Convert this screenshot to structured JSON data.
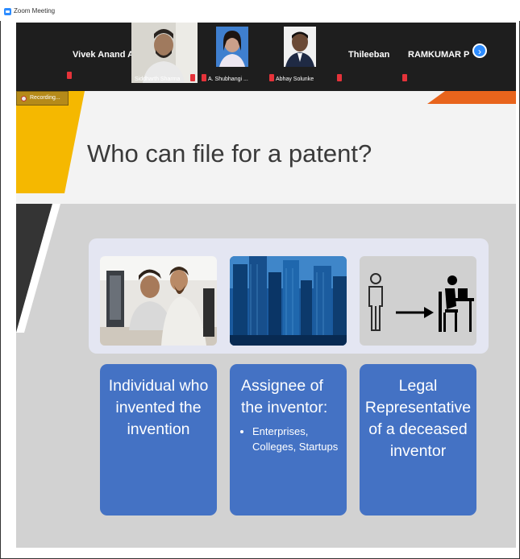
{
  "window": {
    "title": "Zoom Meeting"
  },
  "gallery": {
    "participants": [
      {
        "name": "Vivek Anand A",
        "muted": true
      },
      {
        "name": "Siddharth Sharma",
        "muted": true
      },
      {
        "name": "A. Shubhangi ...",
        "muted": true
      },
      {
        "name": "Abhay Solunke",
        "muted": true
      },
      {
        "name": "",
        "muted": true
      },
      {
        "name": "Thileeban",
        "muted": false
      },
      {
        "name": "RAMKUMAR P",
        "muted": true
      }
    ],
    "next_icon": "chevron-right-icon"
  },
  "recording": {
    "label": "Recording..."
  },
  "slide": {
    "title": "Who can file for a patent?",
    "cards": [
      {
        "text": "Individual who invented the invention",
        "image": "people-working-at-computers"
      },
      {
        "text": "Assignee of the inventor:",
        "bullets": [
          "Enterprises, Colleges, Startups"
        ],
        "image": "city-skyscrapers"
      },
      {
        "text": "Legal Representative of a deceased inventor",
        "image": "person-arrow-person-at-desk-icon"
      }
    ]
  },
  "colors": {
    "card": "#4472c4",
    "accent_yellow": "#f5b800",
    "accent_orange": "#e8641c",
    "zoom_blue": "#2d8cff"
  }
}
